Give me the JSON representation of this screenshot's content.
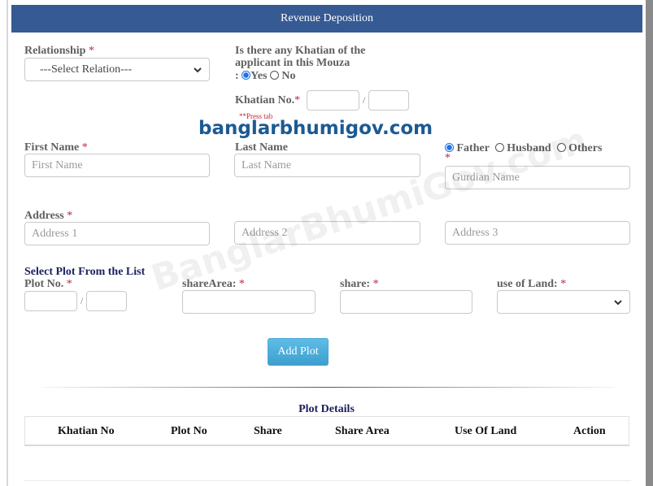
{
  "header": {
    "title": "Revenue Deposition"
  },
  "relationship": {
    "label": "Relationship",
    "required_mark": "*",
    "selected": "---Select Relation---"
  },
  "khatian_question": {
    "line1": "Is there any Khatian of the",
    "line2": "applicant in this Mouza",
    "prefix": ":",
    "options": [
      {
        "label": "Yes",
        "checked": true
      },
      {
        "label": "No",
        "checked": false
      }
    ]
  },
  "khatian_no": {
    "label": "Khatian No.",
    "required_mark": "*",
    "separator": "/",
    "hint": "**Press tab",
    "value1": "",
    "value2": ""
  },
  "brand_overlay": "banglarbhumigov.com",
  "watermark": "BanglarBhumiGov.com",
  "first_name": {
    "label": "First Name",
    "required_mark": "*",
    "placeholder": "First Name"
  },
  "last_name": {
    "label": "Last Name",
    "placeholder": "Last Name"
  },
  "guardian": {
    "options": [
      {
        "label": "Father",
        "checked": true
      },
      {
        "label": "Husband",
        "checked": false
      },
      {
        "label": "Others",
        "checked": false
      }
    ],
    "required_mark": "*",
    "placeholder": "Gurdian Name"
  },
  "address": {
    "label": "Address",
    "required_mark": "*",
    "placeholders": [
      "Address 1",
      "Address 2",
      "Address 3"
    ]
  },
  "plot_section": {
    "title": "Select Plot From the List",
    "plot_no_label": "Plot No.",
    "separator": "/",
    "share_area_label": "shareArea:",
    "share_label": "share:",
    "use_of_land_label": "use of Land:",
    "required_mark": "*",
    "use_of_land_selected": ""
  },
  "add_plot_button": "Add Plot",
  "plot_details": {
    "title": "Plot Details",
    "columns": [
      "Khatian No",
      "Plot No",
      "Share",
      "Share Area",
      "Use Of Land",
      "Action"
    ],
    "rows": []
  },
  "colors": {
    "header_bg": "#365a93",
    "required": "#c0243a",
    "section_title": "#1b1f5e",
    "button": "#4aaedb",
    "radio_checked": "#1a73e8"
  }
}
